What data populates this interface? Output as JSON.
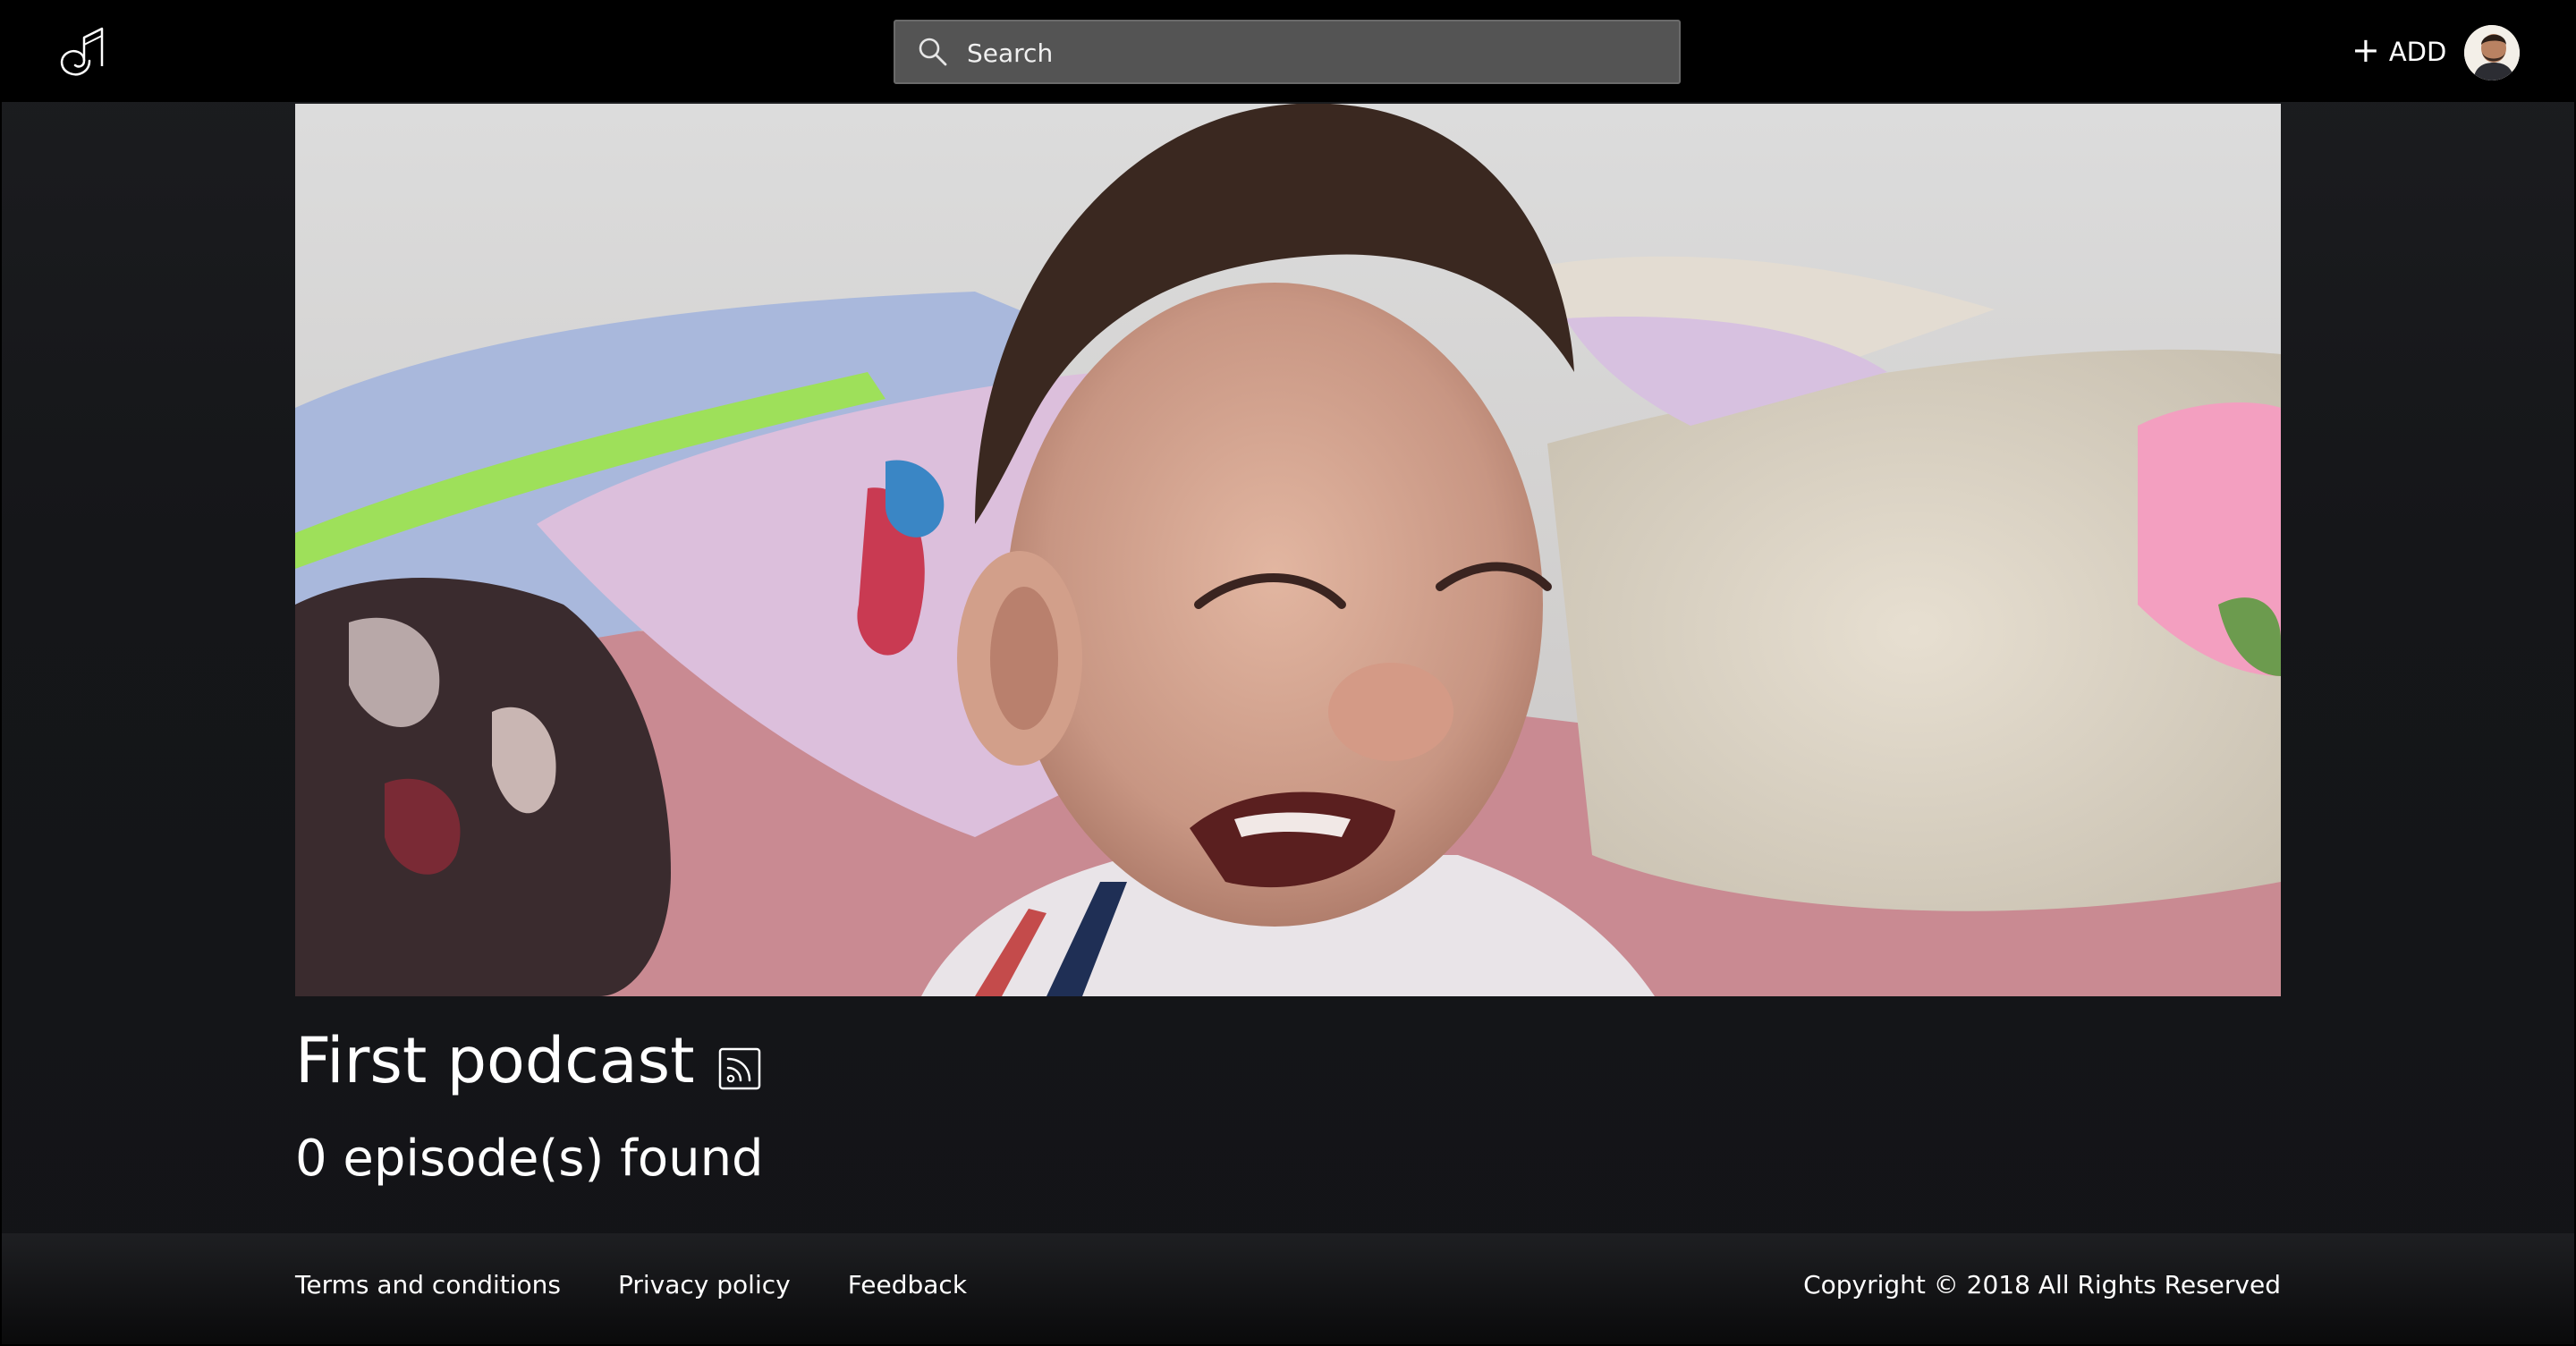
{
  "header": {
    "search_placeholder": "Search",
    "add_label": "ADD"
  },
  "podcast": {
    "title": "First podcast",
    "episodes_found": "0 episode(s) found"
  },
  "footer": {
    "links": [
      "Terms and conditions",
      "Privacy policy",
      "Feedback"
    ],
    "copyright": "Copyright © 2018 All Rights Reserved"
  },
  "icons": {
    "logo": "app-logo",
    "search": "search-icon",
    "add": "plus-icon",
    "rss": "rss-icon"
  },
  "colors": {
    "header_bg": "#000000",
    "page_bg": "#141518",
    "search_bg": "#545454",
    "text": "#ffffff"
  }
}
